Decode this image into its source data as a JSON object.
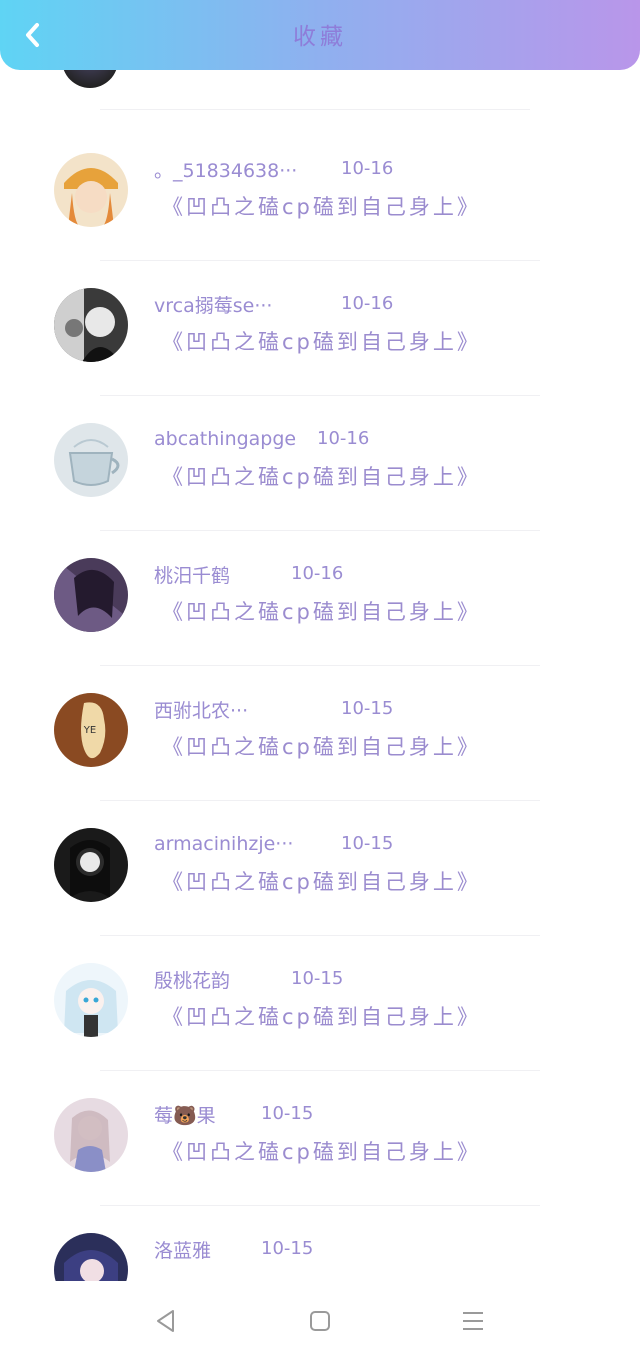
{
  "header": {
    "title": "收藏"
  },
  "items": [
    {
      "username": "。_51834638···",
      "date": "10-16",
      "subtitle": "《凹凸之磕cp磕到自己身上》",
      "avatar_color": "#e9a040"
    },
    {
      "username": "vrca搦莓se···",
      "date": "10-16",
      "subtitle": "《凹凸之磕cp磕到自己身上》",
      "avatar_color": "#2a2a2a"
    },
    {
      "username": "abcathingapge",
      "date": "10-16",
      "subtitle": "《凹凸之磕cp磕到自己身上》",
      "avatar_color": "#cfd8dc"
    },
    {
      "username": "桃汨千鹤",
      "date": "10-16",
      "subtitle": "《凹凸之磕cp磕到自己身上》",
      "avatar_color": "#5a4a6e"
    },
    {
      "username": "西驸北农···",
      "date": "10-15",
      "subtitle": "《凹凸之磕cp磕到自己身上》",
      "avatar_color": "#a0522d"
    },
    {
      "username": "armacinihzje···",
      "date": "10-15",
      "subtitle": "《凹凸之磕cp磕到自己身上》",
      "avatar_color": "#1e1e1e"
    },
    {
      "username": "殷桃花韵",
      "date": "10-15",
      "subtitle": "《凹凸之磕cp磕到自己身上》",
      "avatar_color": "#d9eef7"
    },
    {
      "username": "莓🐻果",
      "date": "10-15",
      "subtitle": "《凹凸之磕cp磕到自己身上》",
      "avatar_color": "#c8b8c8"
    },
    {
      "username": "洛蓝雅",
      "date": "10-15",
      "subtitle": "",
      "avatar_color": "#2b2f5a"
    }
  ],
  "navbar": {
    "back_icon": "triangle-back-icon",
    "home_icon": "square-home-icon",
    "menu_icon": "menu-lines-icon"
  }
}
